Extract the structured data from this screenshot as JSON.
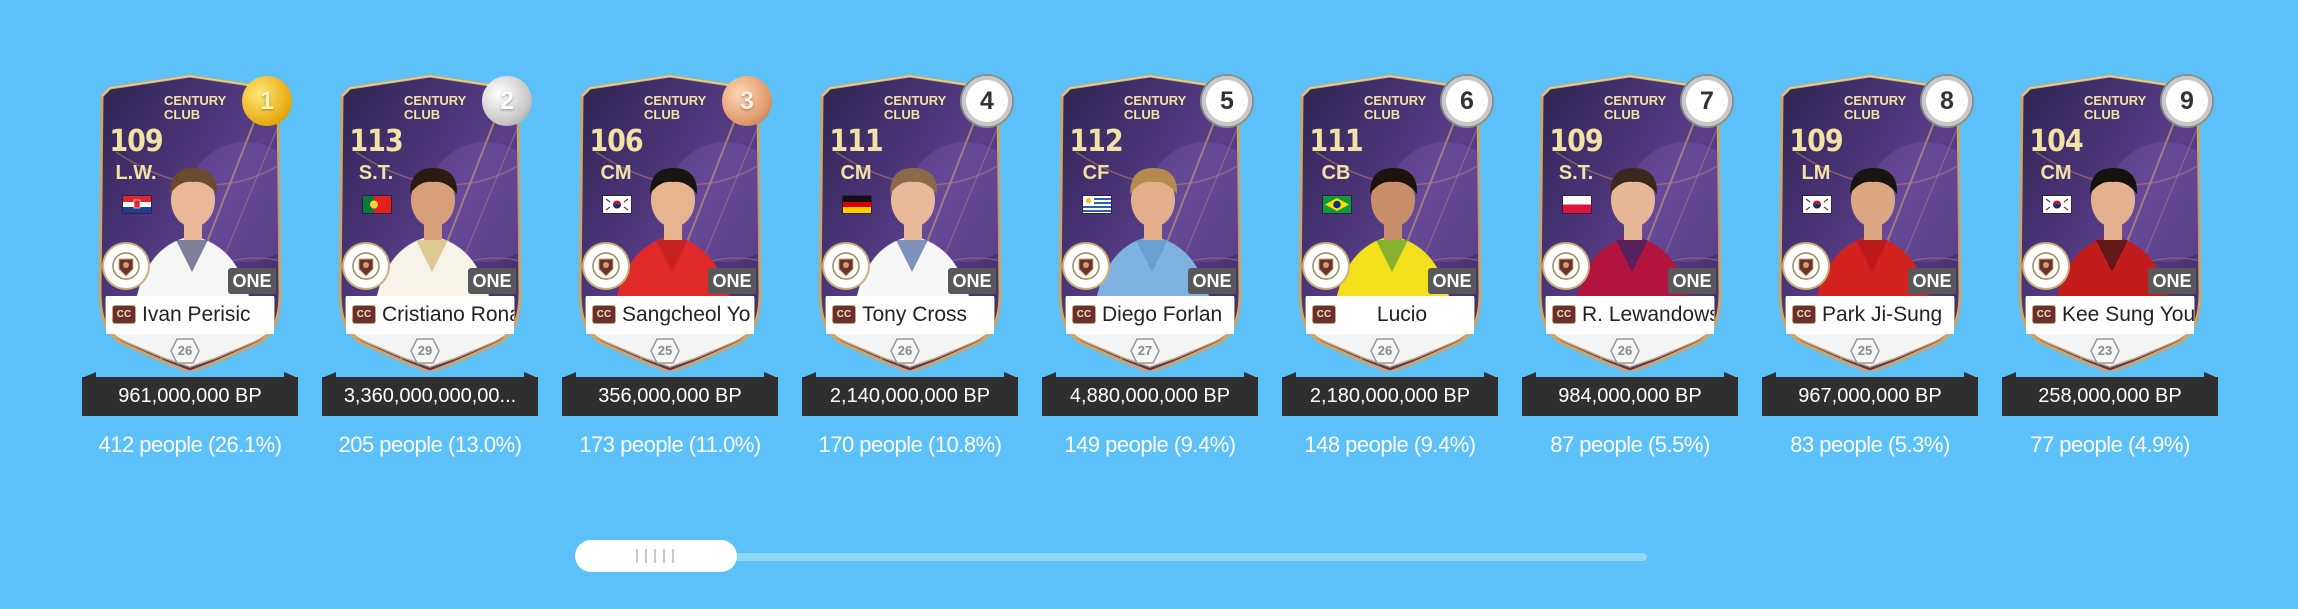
{
  "cards": [
    {
      "rank": "1",
      "medal": "gold",
      "ovr": "109",
      "pos": "L.W.",
      "flag": "croatia",
      "club": "CENTURY\nCLUB",
      "name": "Ivan Perisic",
      "level": "26",
      "badge": "ONE",
      "price": "961,000,000 BP",
      "votes": "412 people (26.1%)",
      "shirt": "#f6f6f6",
      "shirt2": "#1b1e4a",
      "skin": "#e9b898",
      "hair": "#6c4a2f"
    },
    {
      "rank": "2",
      "medal": "silver",
      "ovr": "113",
      "pos": "S.T.",
      "flag": "portugal",
      "club": "CENTURY\nCLUB",
      "name": "Cristiano Rona",
      "level": "29",
      "badge": "ONE",
      "price": "3,360,000,000,00...",
      "votes": "205 people (13.0%)",
      "shirt": "#f7f3e8",
      "shirt2": "#c9a84a",
      "skin": "#d7a07a",
      "hair": "#2b1c12"
    },
    {
      "rank": "3",
      "medal": "bronze",
      "ovr": "106",
      "pos": "CM",
      "flag": "korea",
      "club": "CENTURY\nCLUB",
      "name": "Sangcheol Yo",
      "level": "25",
      "badge": "ONE",
      "price": "356,000,000 BP",
      "votes": "173 people (11.0%)",
      "shirt": "#e02a2a",
      "shirt2": "#b51d1d",
      "skin": "#e6b48e",
      "hair": "#1a1410"
    },
    {
      "rank": "4",
      "medal": "plain",
      "ovr": "111",
      "pos": "CM",
      "flag": "germany",
      "club": "CENTURY\nCLUB",
      "name": "Tony Cross",
      "level": "26",
      "badge": "ONE",
      "price": "2,140,000,000 BP",
      "votes": "170 people (10.8%)",
      "shirt": "#f7f7f7",
      "shirt2": "#1f3d8c",
      "skin": "#e8b99a",
      "hair": "#8b6a4b"
    },
    {
      "rank": "5",
      "medal": "plain",
      "ovr": "112",
      "pos": "CF",
      "flag": "uruguay",
      "club": "CENTURY\nCLUB",
      "name": "Diego Forlan",
      "level": "27",
      "badge": "ONE",
      "price": "4,880,000,000 BP",
      "votes": "149 people (9.4%)",
      "shirt": "#7fb2e0",
      "shirt2": "#5a8fc4",
      "skin": "#e3ae8b",
      "hair": "#b58a4e"
    },
    {
      "rank": "6",
      "medal": "plain",
      "ovr": "111",
      "pos": "CB",
      "flag": "brazil",
      "club": "CENTURY\nCLUB",
      "name": "Lucio",
      "level": "26",
      "badge": "ONE",
      "price": "2,180,000,000 BP",
      "votes": "148 people (9.4%)",
      "shirt": "#f3e01d",
      "shirt2": "#2e8b3a",
      "skin": "#c88e6a",
      "hair": "#1c130d"
    },
    {
      "rank": "7",
      "medal": "plain",
      "ovr": "109",
      "pos": "S.T.",
      "flag": "poland",
      "club": "CENTURY\nCLUB",
      "name": "R. Lewandows",
      "level": "26",
      "badge": "ONE",
      "price": "984,000,000 BP",
      "votes": "87 people (5.5%)",
      "shirt": "#b2133f",
      "shirt2": "#0f2c75",
      "skin": "#e6b898",
      "hair": "#3a2a1e"
    },
    {
      "rank": "8",
      "medal": "plain",
      "ovr": "109",
      "pos": "LM",
      "flag": "korea",
      "club": "CENTURY\nCLUB",
      "name": "Park Ji-Sung",
      "level": "25",
      "badge": "ONE",
      "price": "967,000,000 BP",
      "votes": "83 people (5.3%)",
      "shirt": "#d3231f",
      "shirt2": "#a8131a",
      "skin": "#dba782",
      "hair": "#1a1410"
    },
    {
      "rank": "9",
      "medal": "plain",
      "ovr": "104",
      "pos": "CM",
      "flag": "korea",
      "club": "CENTURY\nCLUB",
      "name": "Kee Sung You",
      "level": "23",
      "badge": "ONE",
      "price": "258,000,000 BP",
      "votes": "77 people (4.9%)",
      "shirt": "#c21b1b",
      "shirt2": "#1a1a1a",
      "skin": "#e3b090",
      "hair": "#15110d"
    }
  ],
  "cc_label": "CC",
  "colors": {
    "background": "#5bc1f8",
    "card_dark": "#2d2352",
    "card_purple": "#5a3e8a",
    "card_gold": "#caa66d",
    "price_bar": "#2f2f2f",
    "text_gold": "#f3e2a6"
  },
  "scroll": {
    "position": 0.0
  }
}
